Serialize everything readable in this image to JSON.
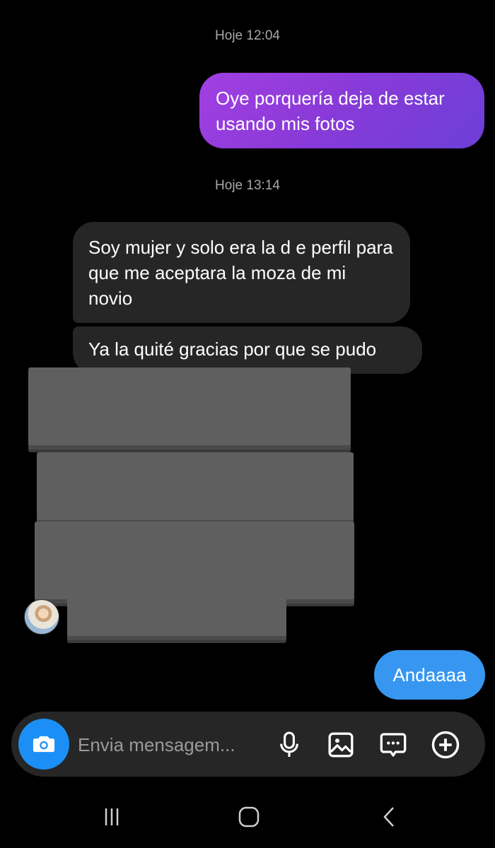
{
  "thread": {
    "timestamp_1": "Hoje 12:04",
    "timestamp_2": "Hoje 13:14",
    "messages": [
      {
        "direction": "outgoing",
        "color": "#8a3ad8",
        "text": "Oye porquería deja de estar usando mis fotos"
      },
      {
        "direction": "incoming",
        "text": "Soy mujer y solo era la d e perfil para que me aceptara la moza de mi novio"
      },
      {
        "direction": "incoming",
        "text": "Ya la quité gracias por que se pudo"
      },
      {
        "direction": "outgoing",
        "color": "#3797f0",
        "text": "Andaaaa"
      }
    ]
  },
  "composer": {
    "placeholder": "Envia mensagem...",
    "icons": [
      "camera-icon",
      "microphone-icon",
      "image-icon",
      "sticker-icon",
      "plus-icon"
    ]
  },
  "navbar": {
    "icons": [
      "recent-apps-icon",
      "home-icon",
      "back-icon"
    ]
  },
  "colors": {
    "background": "#000000",
    "incoming_bubble": "#262626",
    "outgoing_purple": "#8a3ad8",
    "outgoing_blue": "#3797f0",
    "camera_button": "#1b8ff5"
  }
}
